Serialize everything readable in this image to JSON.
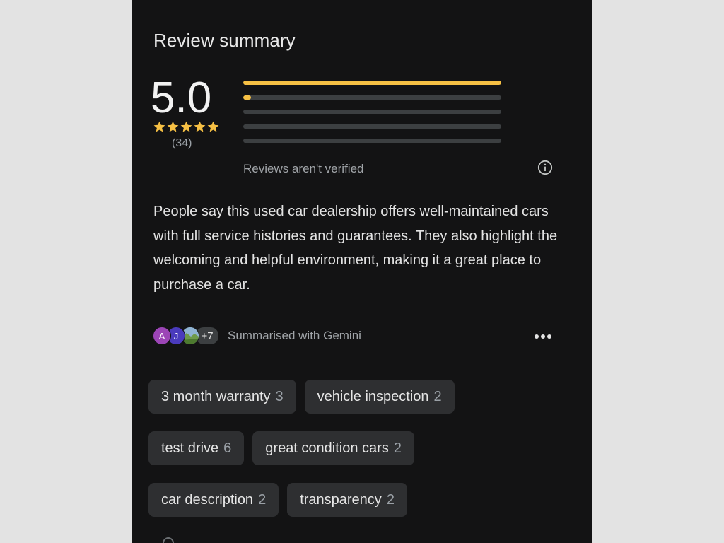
{
  "review_summary": {
    "title": "Review summary",
    "rating": "5.0",
    "stars_filled": 5,
    "review_count": "(34)",
    "distribution": [
      {
        "stars": 5,
        "fraction": 1.0
      },
      {
        "stars": 4,
        "fraction": 0.03
      },
      {
        "stars": 3,
        "fraction": 0.0
      },
      {
        "stars": 2,
        "fraction": 0.0
      },
      {
        "stars": 1,
        "fraction": 0.0
      }
    ],
    "unverified_note": "Reviews aren't verified",
    "info_icon": "info-icon",
    "summary_text": "People say this used car dealership offers well-maintained cars with full service histories and guarantees. They also highlight the welcoming and helpful environment, making it a great place to purchase a car.",
    "attribution": {
      "avatars": [
        {
          "initial": "A",
          "color": "#9c45b6"
        },
        {
          "initial": "J",
          "color": "#4a3bbd"
        },
        {
          "initial": "",
          "kind": "photo"
        }
      ],
      "more_count": "+7",
      "label": "Summarised with Gemini"
    },
    "more_menu_icon": "more-horizontal-icon",
    "topics": [
      {
        "label": "3 month warranty",
        "count": "3"
      },
      {
        "label": "vehicle inspection",
        "count": "2"
      },
      {
        "label": "test drive",
        "count": "6"
      },
      {
        "label": "great condition cars",
        "count": "2"
      },
      {
        "label": "car description",
        "count": "2"
      },
      {
        "label": "transparency",
        "count": "2"
      }
    ]
  },
  "colors": {
    "background": "#131314",
    "accent_star": "#f6c044",
    "chip_bg": "#2e2f31",
    "muted_text": "#a0a4a8"
  }
}
